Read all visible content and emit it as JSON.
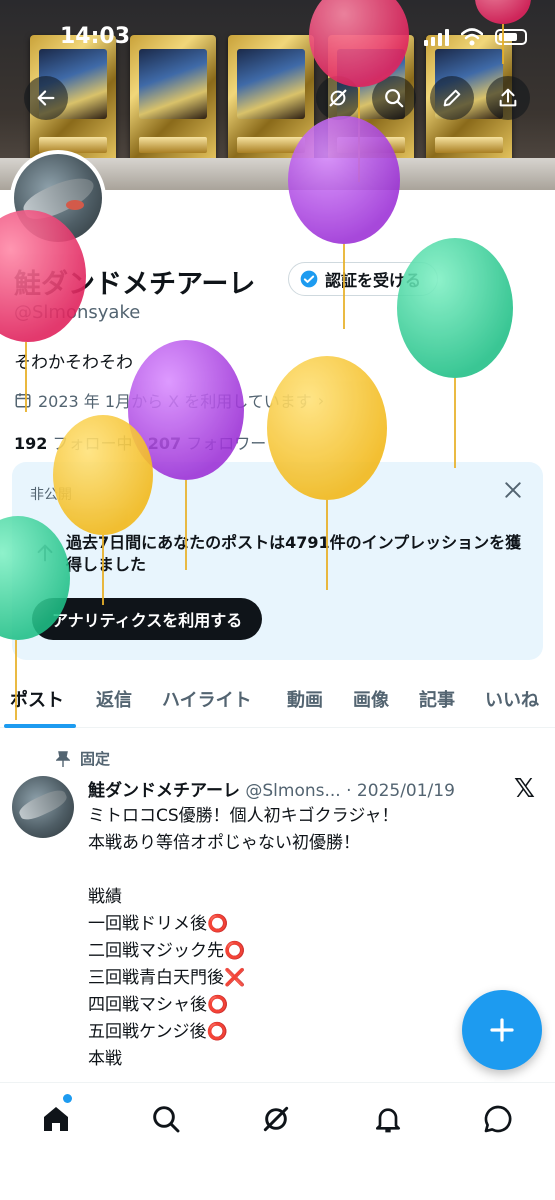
{
  "status_bar": {
    "time": "14:03"
  },
  "profile": {
    "name": "鮭ダンドメチアーレ",
    "verify_label": "認証を受ける",
    "handle": "@Slmonsyake",
    "bio": "そわかそわそわ",
    "joined": "2023 年 1月から X を利用しています",
    "following_count": "192",
    "following_label": "フォロー中",
    "followers_count": "207",
    "followers_label": "フォロワー"
  },
  "analytics_card": {
    "private_label": "非公開",
    "message": "過去7日間にあなたのポストは4791件のインプレッションを獲得しました",
    "button_label": "アナリティクスを利用する"
  },
  "tabs": [
    {
      "label": "ポスト"
    },
    {
      "label": "返信"
    },
    {
      "label": "ハイライト"
    },
    {
      "label": "動画"
    },
    {
      "label": "画像"
    },
    {
      "label": "記事"
    },
    {
      "label": "いいね"
    }
  ],
  "post": {
    "pinned_label": "固定",
    "author_name": "鮭ダンドメチアーレ",
    "author_handle": "@Slmons...",
    "date": "· 2025/01/19",
    "lines": [
      "ミトロコCS優勝！個人初キゴクラジャ！",
      "本戦あり等倍オポじゃない初優勝！",
      "",
      "戦績",
      "一回戦ドリメ後",
      "二回戦マジック先",
      "三回戦青白天門後",
      "四回戦マシャ後",
      "五回戦ケンジ後",
      "本戦"
    ],
    "marks": [
      "",
      "",
      "",
      "",
      "⭕",
      "⭕",
      "❌",
      "⭕",
      "⭕",
      ""
    ]
  },
  "icons": {
    "back": "back-arrow-icon",
    "grok": "grok-icon",
    "search": "search-icon",
    "edit": "edit-pencil-icon",
    "share": "share-icon",
    "verified": "verified-badge-icon",
    "calendar": "calendar-icon",
    "close": "close-icon",
    "pin": "pin-icon",
    "compose": "compose-plus-icon",
    "home": "home-icon",
    "notifications": "bell-icon",
    "messages": "messages-icon"
  },
  "colors": {
    "accent": "#1d9bf0",
    "text": "#0f1419",
    "muted": "#536471",
    "card_bg": "#e8f5fd"
  }
}
